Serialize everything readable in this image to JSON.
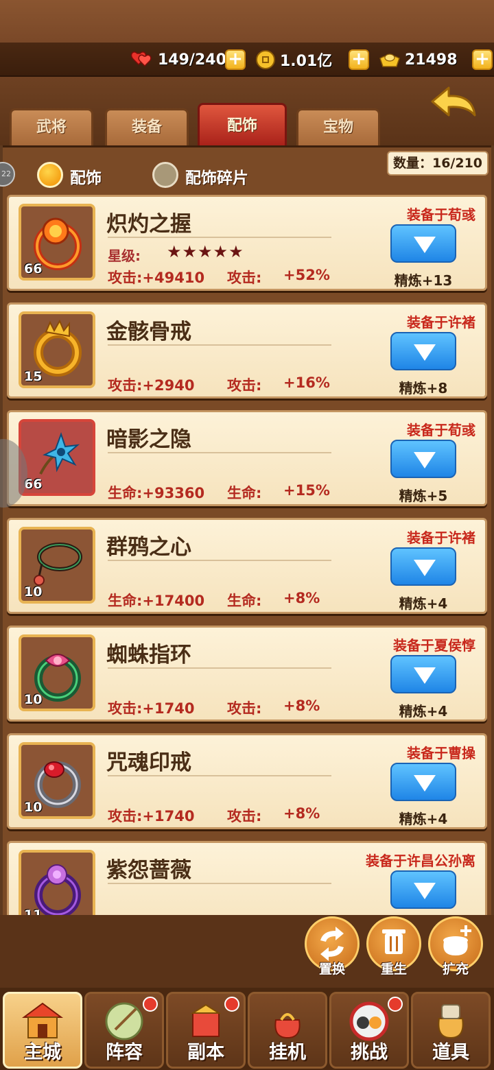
{
  "resources": {
    "stamina": "149/240",
    "coins": "1.01亿",
    "gold": "21498"
  },
  "tabs": [
    {
      "label": "武将",
      "active": false
    },
    {
      "label": "装备",
      "active": false
    },
    {
      "label": "配饰",
      "active": true
    },
    {
      "label": "宝物",
      "active": false
    }
  ],
  "filters": {
    "accessory": "配饰",
    "fragments": "配饰碎片"
  },
  "count": "数量：16/210",
  "side_badge": "22",
  "items": [
    {
      "name": "炽灼之握",
      "level": "66",
      "frame": "gold",
      "equipped": "装备于荀彧",
      "stars_label": "星级:",
      "stars": "★★★★★",
      "stat1": "攻击:+49410",
      "stat2_label": "攻击:",
      "stat2_value": "+52%",
      "refine": "精炼+13",
      "icon": "fire-ring-icon"
    },
    {
      "name": "金骸骨戒",
      "level": "15",
      "frame": "gold",
      "equipped": "装备于许褚",
      "stat1": "攻击:+2940",
      "stat2_label": "攻击:",
      "stat2_value": "+16%",
      "refine": "精炼+8",
      "icon": "golden-dragon-ring-icon"
    },
    {
      "name": "暗影之隐",
      "level": "66",
      "frame": "red",
      "equipped": "装备于荀彧",
      "stat1": "生命:+93360",
      "stat2_label": "生命:",
      "stat2_value": "+15%",
      "refine": "精炼+5",
      "icon": "shadow-shuriken-icon"
    },
    {
      "name": "群鸦之心",
      "level": "10",
      "frame": "gold",
      "equipped": "装备于许褚",
      "stat1": "生命:+17400",
      "stat2_label": "生命:",
      "stat2_value": "+8%",
      "refine": "精炼+4",
      "icon": "crow-necklace-icon"
    },
    {
      "name": "蜘蛛指环",
      "level": "10",
      "frame": "gold",
      "equipped": "装备于夏侯惇",
      "stat1": "攻击:+1740",
      "stat2_label": "攻击:",
      "stat2_value": "+8%",
      "refine": "精炼+4",
      "icon": "spider-ring-icon"
    },
    {
      "name": "咒魂印戒",
      "level": "10",
      "frame": "gold",
      "equipped": "装备于曹操",
      "stat1": "攻击:+1740",
      "stat2_label": "攻击:",
      "stat2_value": "+8%",
      "refine": "精炼+4",
      "icon": "cursed-ring-icon"
    },
    {
      "name": "紫怨蔷薇",
      "level": "11",
      "frame": "gold",
      "equipped": "装备于许昌公孙离",
      "stat1": "",
      "stat2_label": "",
      "stat2_value": "",
      "refine": "",
      "icon": "purple-rose-ring-icon"
    }
  ],
  "actions": [
    {
      "label": "置换",
      "icon": "swap-icon"
    },
    {
      "label": "重生",
      "icon": "trash-icon"
    },
    {
      "label": "扩充",
      "icon": "expand-bag-icon"
    }
  ],
  "nav": [
    {
      "label": "主城",
      "active": true,
      "dot": false
    },
    {
      "label": "阵容",
      "active": false,
      "dot": true
    },
    {
      "label": "副本",
      "active": false,
      "dot": true
    },
    {
      "label": "挂机",
      "active": false,
      "dot": false
    },
    {
      "label": "挑战",
      "active": false,
      "dot": true
    },
    {
      "label": "道具",
      "active": false,
      "dot": false
    }
  ]
}
